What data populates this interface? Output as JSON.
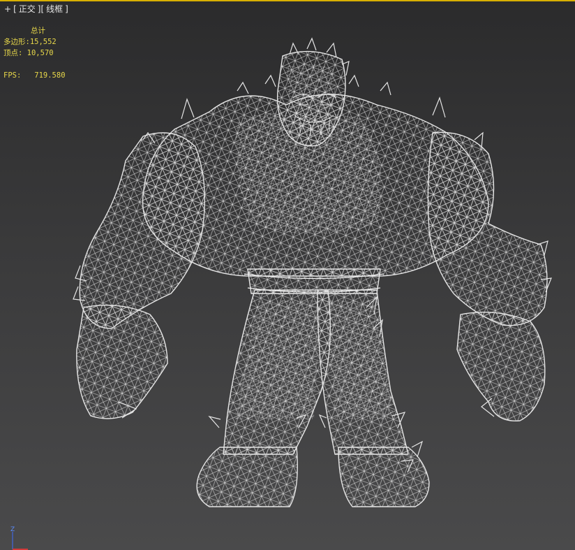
{
  "viewport": {
    "menu_plus": "+",
    "menu_bracket_open": "[",
    "view_name": "正交",
    "menu_bracket_mid": "][",
    "shading_mode": "线框",
    "menu_bracket_close": "]",
    "background_color": "#3a3a3b",
    "active_border_color": "#d8b000"
  },
  "stats": {
    "header": "总计",
    "polygons_label": "多边形:",
    "polygons_value": "15,552",
    "vertices_label": "顶点:",
    "vertices_value": "10,570",
    "fps_label": "FPS:",
    "fps_value": "719.580",
    "text_color": "#e8d84a"
  },
  "model": {
    "description_icon": "wireframe-creature",
    "wire_color": "#e0e0e0"
  },
  "gizmo": {
    "z_label": "Z"
  }
}
